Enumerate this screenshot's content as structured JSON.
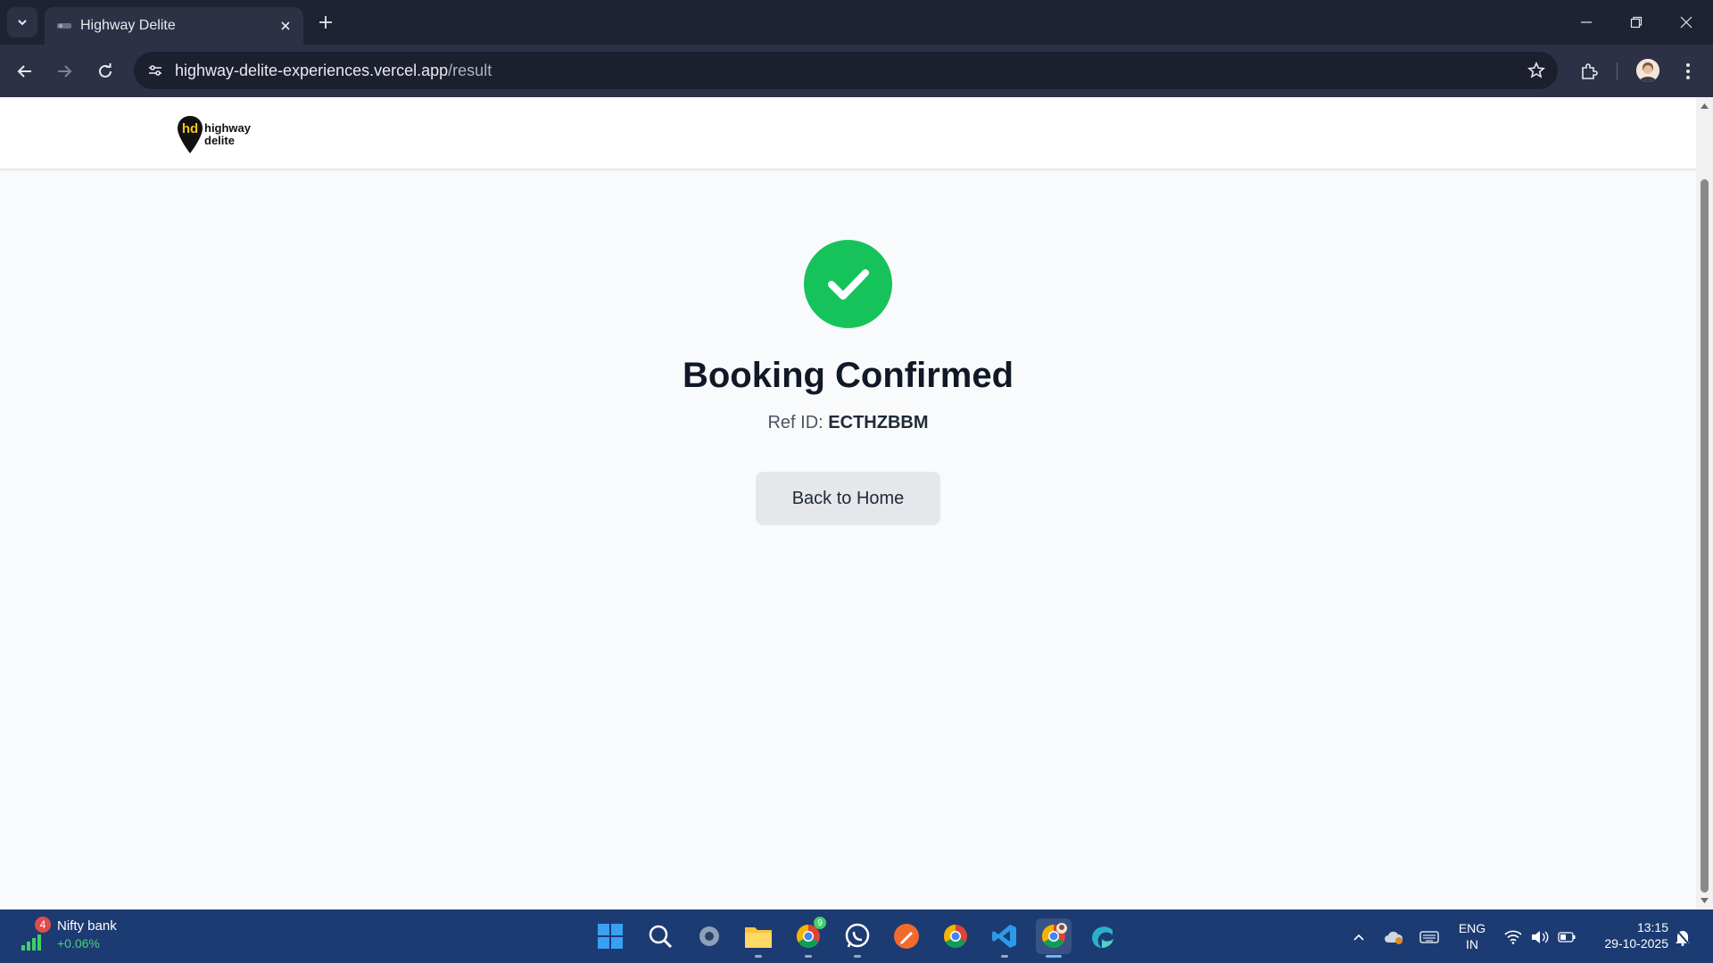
{
  "browser": {
    "tab_title": "Highway Delite",
    "url_host": "highway-delite-experiences.vercel.app",
    "url_path": "/result"
  },
  "page": {
    "logo_line1": "highway",
    "logo_line2": "delite",
    "confirm_title": "Booking Confirmed",
    "ref_label": "Ref ID:",
    "ref_value": "ECTHZBBM",
    "back_button": "Back to Home",
    "success_color": "#15c35a"
  },
  "taskbar": {
    "widget_badge": "4",
    "widget_title": "Nifty bank",
    "widget_change": "+0.06%",
    "chrome_badge": "9",
    "lang_line1": "ENG",
    "lang_line2": "IN",
    "time": "13:15",
    "date": "29-10-2025",
    "apps": [
      "start-icon",
      "search-icon",
      "settings-icon",
      "file-explorer-icon",
      "chrome-icon",
      "whatsapp-icon",
      "pen-app-icon",
      "chrome-icon",
      "vscode-icon",
      "chrome-profile-icon",
      "edge-copilot-icon"
    ]
  }
}
